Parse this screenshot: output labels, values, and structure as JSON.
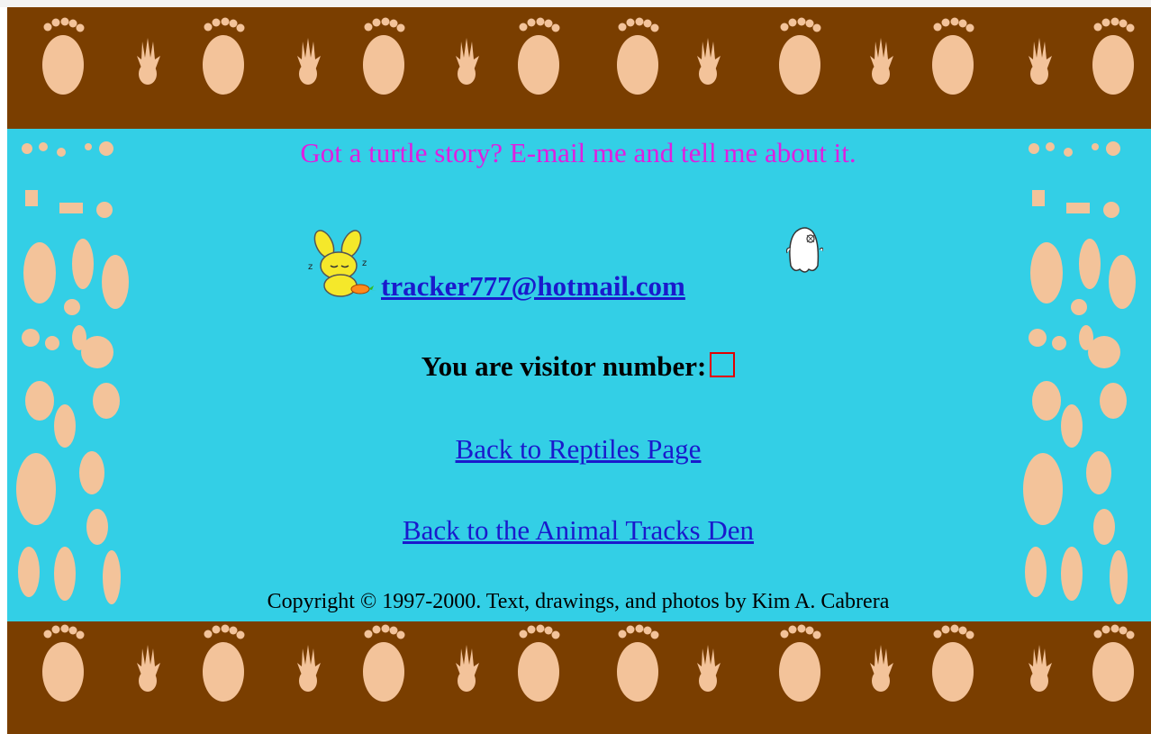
{
  "page": {
    "story_prompt": "Got a turtle story? E-mail me and tell me about it.",
    "email": "tracker777@hotmail.com",
    "visitor_label": "You are visitor number:",
    "links": {
      "reptiles": "Back to Reptiles Page",
      "den": "Back to the Animal Tracks Den"
    },
    "copyright": "Copyright © 1997-2000. Text, drawings, and photos by Kim A. Cabrera"
  },
  "colors": {
    "band_brown": "#7a3e00",
    "track_peach": "#f3c39a",
    "background_cyan": "#33cfe6",
    "story_text": "#e01ee0",
    "link_blue": "#1a1acc",
    "counter_border": "#e00000"
  },
  "icons": {
    "bunny": "sleeping-bunny-icon",
    "ghost": "ghost-icon",
    "band_tracks": "animal-track-icon"
  }
}
